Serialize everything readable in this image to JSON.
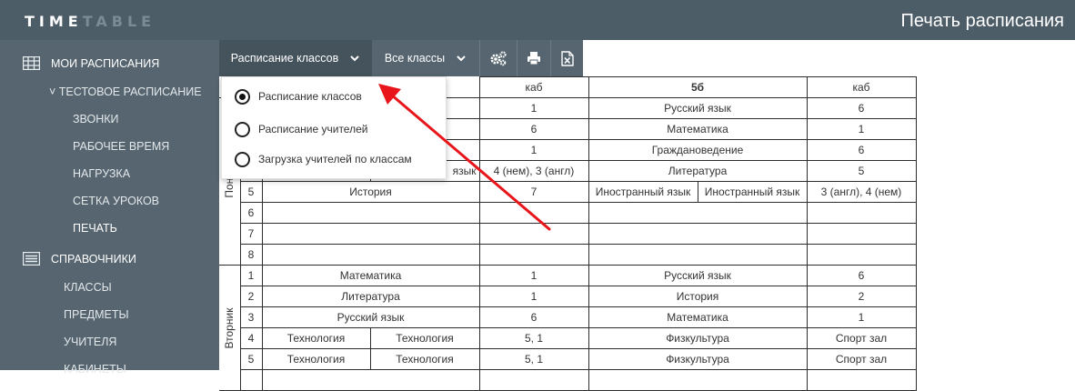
{
  "header": {
    "logo_bright": "TIME",
    "logo_dim": "TABLE",
    "page_title": "Печать расписания"
  },
  "sidebar": {
    "sections": [
      {
        "label": "МОИ РАСПИСАНИЯ",
        "icon": "grid-icon"
      },
      {
        "label": "СПРАВОЧНИКИ",
        "icon": "list-icon"
      }
    ],
    "schedule_toggle": "˅ ТЕСТОВОЕ РАСПИСАНИЕ",
    "schedule_items": [
      "ЗВОНКИ",
      "РАБОЧЕЕ ВРЕМЯ",
      "НАГРУЗКА",
      "СЕТКА УРОКОВ",
      "ПЕЧАТЬ"
    ],
    "ref_items": [
      "КЛАССЫ",
      "ПРЕДМЕТЫ",
      "УЧИТЕЛЯ",
      "КАБИНЕТЫ"
    ]
  },
  "toolbar": {
    "view_label": "Расписание классов",
    "filter_label": "Все классы"
  },
  "dropdown": {
    "options": [
      "Расписание классов",
      "Расписание учителей",
      "Загрузка учителей по классам"
    ],
    "selected": 0
  },
  "table": {
    "header": {
      "room1": "каб",
      "class2": "5б",
      "room2": "каб"
    },
    "days": [
      "Понед",
      "Вторник"
    ],
    "monday": [
      {
        "n": "",
        "s1": "",
        "r1": "1",
        "s2": "Русский язык",
        "r2": "6"
      },
      {
        "n": "",
        "s1": "",
        "r1": "6",
        "s2": "Математика",
        "r2": "1"
      },
      {
        "n": "",
        "s1": "",
        "r1": "1",
        "s2": "Граждановедение",
        "r2": "6"
      },
      {
        "n": "",
        "s1": "язык",
        "r1": "4 (нем), 3 (англ)",
        "s2": "Литература",
        "r2": "5"
      },
      {
        "n": "5",
        "s1": "История",
        "r1": "7",
        "s2a": "Иностранный язык",
        "s2b": "Иностранный язык",
        "r2": "3 (англ), 4 (нем)"
      },
      {
        "n": "6"
      },
      {
        "n": "7"
      },
      {
        "n": "8"
      }
    ],
    "tuesday": [
      {
        "n": "1",
        "s1": "Математика",
        "r1": "1",
        "s2": "Русский язык",
        "r2": "6"
      },
      {
        "n": "2",
        "s1": "Литература",
        "r1": "1",
        "s2": "История",
        "r2": "2"
      },
      {
        "n": "3",
        "s1": "Русский язык",
        "r1": "6",
        "s2": "Математика",
        "r2": "1"
      },
      {
        "n": "4",
        "s1a": "Технология",
        "s1b": "Технология",
        "r1": "5, 1",
        "s2": "Физкультура",
        "r2": "Спорт зал"
      },
      {
        "n": "5",
        "s1a": "Технология",
        "s1b": "Технология",
        "r1": "5, 1",
        "s2": "Физкультура",
        "r2": "Спорт зал"
      }
    ]
  }
}
